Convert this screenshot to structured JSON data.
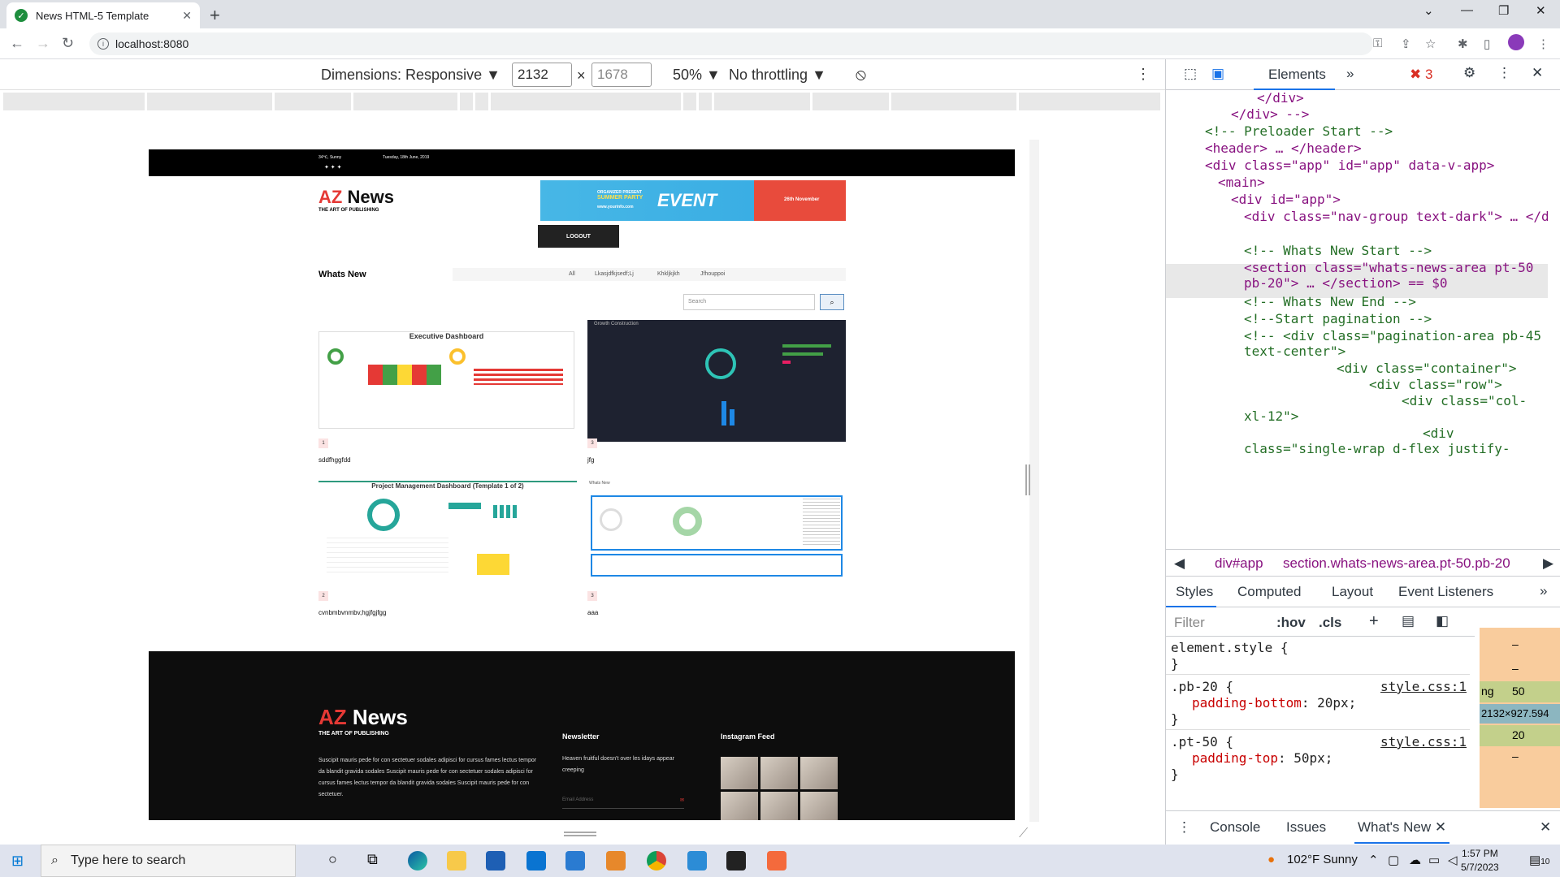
{
  "browser": {
    "tab_title": "News HTML-5 Template",
    "url": "localhost:8080"
  },
  "device_toolbar": {
    "dimensions_label": "Dimensions: Responsive",
    "width": "2132",
    "height": "1678",
    "zoom": "50%",
    "throttling": "No throttling"
  },
  "site": {
    "weather": "34℃, Sunny",
    "date": "Tuesday, 18th June, 2019",
    "logo_az": "AZ",
    "logo_news": "News",
    "tagline": "THE ART OF PUBLISHING",
    "banner_event": "EVENT",
    "banner_organizer": "ORGANIZER PRESENT",
    "banner_party": "SUMMER PARTY",
    "banner_site": "www.yourinfo.com",
    "banner_date": "26th November",
    "logout": "LOGOUT",
    "whats_new": "Whats New",
    "filter_tabs": [
      "All",
      "Lkasjdfkjsedf;Lj",
      "Khkljkjkh",
      "Jfhouppoi"
    ],
    "search_placeholder": "Search",
    "cards": [
      {
        "badge": "1",
        "caption": "sddfhggfdd",
        "image_title": "Executive Dashboard"
      },
      {
        "badge": "3",
        "caption": "jfg",
        "image_title": "Growth Construction"
      },
      {
        "badge": "2",
        "caption": "cvnbmbvnmbv,hgjfgjfgg",
        "image_title": "Project Management Dashboard (Template 1 of 2)"
      },
      {
        "badge": "3",
        "caption": "aaa",
        "image_title": "Whats New"
      }
    ],
    "footer": {
      "about": "Suscipit mauris pede for con sectetuer sodales adipisci for cursus fames lectus tempor da blandit gravida sodales Suscipit mauris pede for con sectetuer sodales adipisci for cursus fames lectus tempor da blandit gravida sodales Suscipit mauris pede for con sectetuer.",
      "newsletter_title": "Newsletter",
      "newsletter_text": "Heaven fruitful doesn't over les idays appear creeping",
      "email_placeholder": "Email Address",
      "instagram_title": "Instagram Feed"
    }
  },
  "devtools": {
    "panel": "Elements",
    "error_count": "3",
    "breadcrumb": [
      "div#app",
      "section.whats-news-area.pt-50.pb-20"
    ],
    "style_tabs": [
      "Styles",
      "Computed",
      "Layout",
      "Event Listeners"
    ],
    "filter_placeholder": "Filter",
    "hov": ":hov",
    "cls": ".cls",
    "drawer_tabs": [
      "Console",
      "Issues",
      "What's New"
    ],
    "dom_lines": [
      "</div>",
      "</div> -->",
      "<!-- Preloader Start -->",
      "<header> … </header>",
      "<div class=\"app\" id=\"app\" data-v-app>",
      "<main>",
      "<div id=\"app\">",
      "<div class=\"nav-group text-dark\"> … </div>",
      "<!-- Whats New Start -->",
      "<section class=\"whats-news-area pt-50 pb-20\"> … </section> == $0",
      "<!-- Whats New End -->",
      "<!--Start pagination -->",
      "<!-- <div class=\"pagination-area pb-45 text-center\">",
      "<div class=\"container\">",
      "<div class=\"row\">",
      "<div class=\"col-xl-12\">",
      "<div class=\"single-wrap d-flex justify-"
    ],
    "styles": {
      "element_style": "element.style {",
      "rule1_selector": ".pb-20 {",
      "rule1_prop": "padding-bottom",
      "rule1_value": "20px;",
      "rule2_selector": ".pt-50 {",
      "rule2_prop": "padding-top",
      "rule2_value": "50px;",
      "source": "style.css:1"
    },
    "box_model": {
      "dash1": "–",
      "dash2": "–",
      "padding_label": "ng",
      "padding_top": "50",
      "size": "2132×927.594",
      "padding_bottom": "20",
      "dash3": "–"
    }
  },
  "taskbar": {
    "search_placeholder": "Type here to search",
    "weather": "102°F  Sunny",
    "time": "1:57 PM",
    "date": "5/7/2023",
    "notifications": "10"
  }
}
